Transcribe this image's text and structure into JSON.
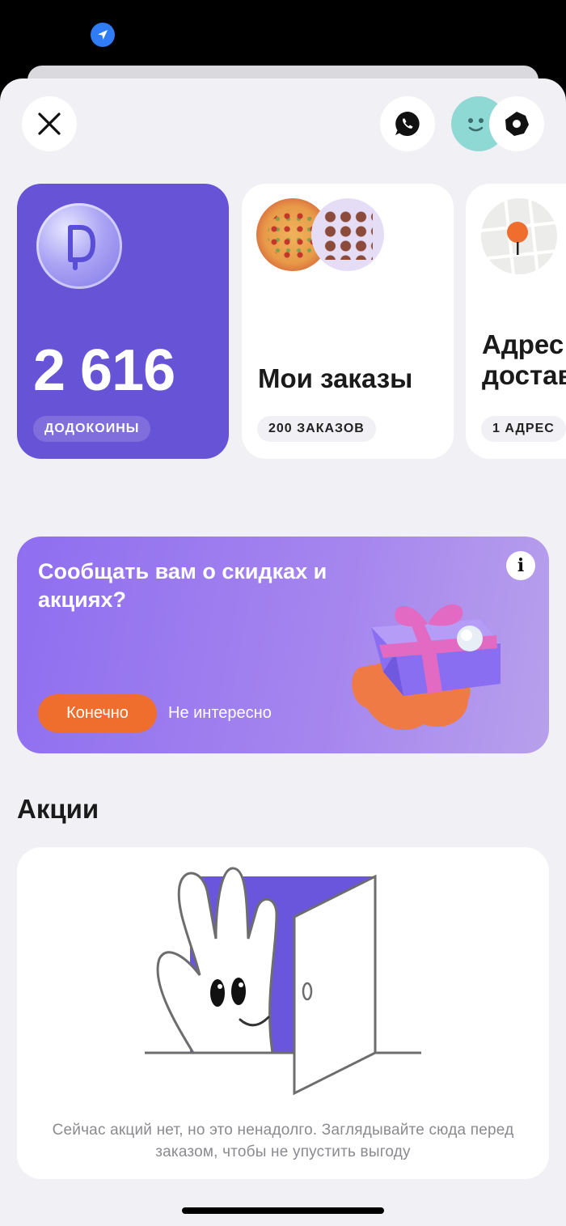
{
  "header": {
    "close_icon": "close-icon",
    "chat_icon": "whatsapp-chat-icon",
    "avatar_icon": "face-avatar-icon",
    "settings_icon": "gear-icon"
  },
  "cards": {
    "coins": {
      "value": "2 616",
      "label": "ДОДОКОИНЫ"
    },
    "orders": {
      "title": "Мои заказы",
      "label": "200 ЗАКАЗОВ"
    },
    "address": {
      "title_line1": "Адрес",
      "title_line2": "доставки",
      "label": "1 АДРЕС"
    }
  },
  "promo": {
    "text": "Сообщать вам о скидках и акциях?",
    "confirm_label": "Конечно",
    "decline_label": "Не интересно",
    "info_label": "i"
  },
  "promotions": {
    "title": "Акции",
    "empty_text": "Сейчас акций нет, но это ненадолго. Заглядывайте сюда перед заказом, чтобы не упустить выгоду"
  },
  "colors": {
    "accent_purple": "#6753d6",
    "accent_orange": "#ef6d2d",
    "background": "#f1f1f5",
    "location_blue": "#2f7cf6"
  }
}
